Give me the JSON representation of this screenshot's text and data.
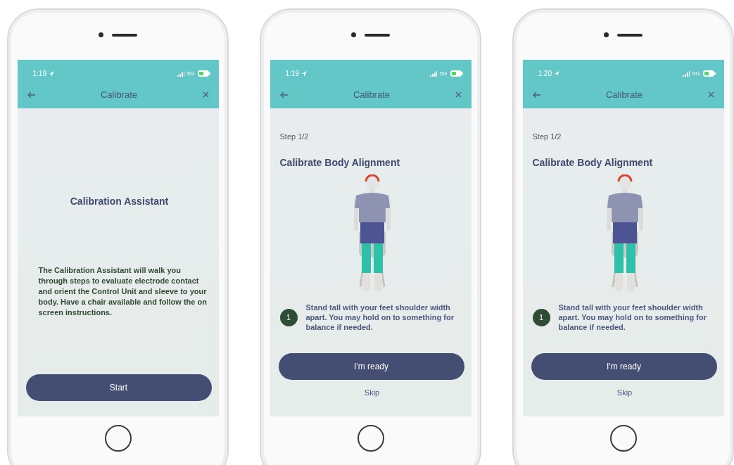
{
  "phones": [
    {
      "kind": "intro",
      "status_bar": {
        "time": "1:19",
        "network": "5G"
      },
      "header": {
        "title": "Calibrate"
      },
      "title": "Calibration Assistant",
      "body": "The Calibration Assistant will walk you through steps to evaluate electrode contact and orient the Control Unit and sleeve to your body. Have a chair available and follow the on screen instructions.",
      "button": "Start"
    },
    {
      "kind": "step",
      "status_bar": {
        "time": "1:19",
        "network": "5G"
      },
      "header": {
        "title": "Calibrate"
      },
      "step": "Step 1/2",
      "title": "Calibrate Body Alignment",
      "instruction": {
        "number": "1",
        "text": "Stand tall with your feet shoulder width apart. You may hold on to something for balance if needed."
      },
      "button": "I'm ready",
      "link": "Skip"
    },
    {
      "kind": "step",
      "status_bar": {
        "time": "1:20",
        "network": "5G"
      },
      "header": {
        "title": "Calibrate"
      },
      "step": "Step 1/2",
      "title": "Calibrate Body Alignment",
      "instruction": {
        "number": "1",
        "text": "Stand tall with your feet shoulder width apart. You may hold on to something for balance if needed."
      },
      "button": "I'm ready",
      "link": "Skip"
    }
  ]
}
